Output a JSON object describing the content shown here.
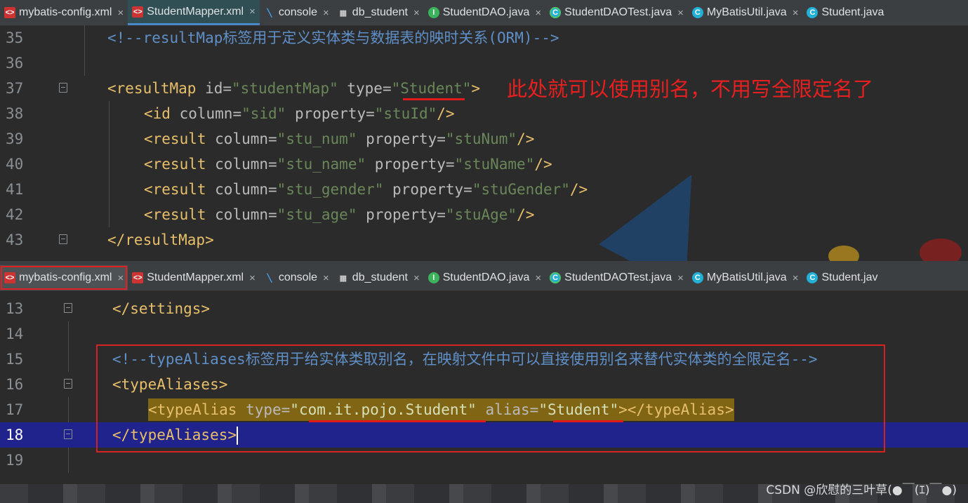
{
  "top_tabs": [
    {
      "label": "mybatis-config.xml",
      "icon": "xml-file-icon"
    },
    {
      "label": "StudentMapper.xml",
      "icon": "xml-file-icon",
      "active": true
    },
    {
      "label": "console",
      "icon": "console-icon"
    },
    {
      "label": "db_student",
      "icon": "table-icon"
    },
    {
      "label": "StudentDAO.java",
      "icon": "interface-icon"
    },
    {
      "label": "StudentDAOTest.java",
      "icon": "test-class-icon"
    },
    {
      "label": "MyBatisUtil.java",
      "icon": "class-icon"
    },
    {
      "label": "Student.java",
      "icon": "class-icon"
    }
  ],
  "top_editor": {
    "lines": [
      {
        "num": "35",
        "comment": "<!--resultMap标签用于定义实体类与数据表的映时关系(ORM)-->"
      },
      {
        "num": "36"
      },
      {
        "num": "37",
        "open": "<resultMap",
        "attr1": " id=",
        "val1": "\"studentMap\"",
        "attr2": " type=",
        "val2": "\"Student\"",
        "close": ">"
      },
      {
        "num": "38",
        "open": "<id",
        "attr1": " column=",
        "val1": "\"sid\"",
        "attr2": " property=",
        "val2": "\"stuId\"",
        "close": "/>"
      },
      {
        "num": "39",
        "open": "<result",
        "attr1": " column=",
        "val1": "\"stu_num\"",
        "attr2": " property=",
        "val2": "\"stuNum\"",
        "close": "/>"
      },
      {
        "num": "40",
        "open": "<result",
        "attr1": " column=",
        "val1": "\"stu_name\"",
        "attr2": " property=",
        "val2": "\"stuName\"",
        "close": "/>"
      },
      {
        "num": "41",
        "open": "<result",
        "attr1": " column=",
        "val1": "\"stu_gender\"",
        "attr2": " property=",
        "val2": "\"stuGender\"",
        "close": "/>"
      },
      {
        "num": "42",
        "open": "<result",
        "attr1": " column=",
        "val1": "\"stu_age\"",
        "attr2": " property=",
        "val2": "\"stuAge\"",
        "close": "/>"
      },
      {
        "num": "43",
        "tag": "</resultMap>"
      }
    ]
  },
  "annotation_text": "此处就可以使用别名，不用写全限定名了",
  "bottom_tabs": [
    {
      "label": "mybatis-config.xml",
      "icon": "xml-file-icon",
      "active": true
    },
    {
      "label": "StudentMapper.xml",
      "icon": "xml-file-icon"
    },
    {
      "label": "console",
      "icon": "console-icon"
    },
    {
      "label": "db_student",
      "icon": "table-icon"
    },
    {
      "label": "StudentDAO.java",
      "icon": "interface-icon"
    },
    {
      "label": "StudentDAOTest.java",
      "icon": "test-class-icon"
    },
    {
      "label": "MyBatisUtil.java",
      "icon": "class-icon"
    },
    {
      "label": "Student.jav",
      "icon": "class-icon"
    }
  ],
  "bottom_editor": {
    "lines": [
      {
        "num": "13",
        "tag": "</settings>"
      },
      {
        "num": "14"
      },
      {
        "num": "15",
        "comment": "<!--typeAliases标签用于给实体类取别名，在映射文件中可以直接使用别名来替代实体类的全限定名-->"
      },
      {
        "num": "16",
        "tag": "<typeAliases>"
      },
      {
        "num": "17",
        "open": "<typeAlias",
        "attr1": " type=",
        "val1": "\"com.it.pojo.Student\"",
        "attr2": " alias=",
        "val2": "\"Student\"",
        "close": "></typeAlias>"
      },
      {
        "num": "18",
        "tag": "</typeAliases>"
      },
      {
        "num": "19"
      }
    ]
  },
  "watermark": "CSDN @欣慰的三叶草(●￣(ｴ)￣●)",
  "colors": {
    "accent_red": "#e81f1f",
    "xml_tag": "#e8bf6a",
    "xml_value": "#6a8759",
    "comment": "#629755",
    "current_line": "#21238c",
    "highlight": "#806515"
  }
}
